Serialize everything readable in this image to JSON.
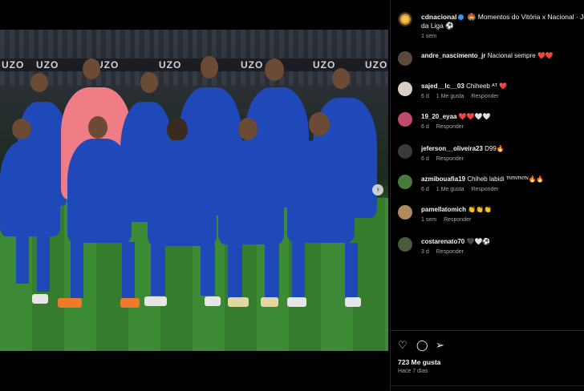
{
  "post": {
    "author": "cdnacional",
    "caption_line1": " 🏟️ Momentos do Vitória x Nacional · Jorn",
    "caption_line2": "da Liga ⚽",
    "time": "1 sem",
    "likes": "723 Me gusta",
    "posted": "Hace 7 días",
    "carousel_dots": 8,
    "carousel_active": 1
  },
  "photo": {
    "banner_words": [
      "UZO",
      "UZO",
      "UZO",
      "UZO",
      "UZO",
      "UZO",
      "UZO"
    ],
    "next_icon": "›"
  },
  "comments": [
    {
      "user": "andre_nascimento_jr",
      "text": "Nacional sempre ❤️❤️",
      "meta": [],
      "avatar_color": "#5a4a3c"
    },
    {
      "user": "sajed__lc__03",
      "text": "Chiheeb ᴬᵀ ❤️",
      "meta": [
        "6 d",
        "1 Me gusta",
        "Responder"
      ],
      "avatar_color": "#d8cfc4"
    },
    {
      "user": "19_20_eyaa",
      "text": "❤️❤️🤍🤍",
      "meta": [
        "6 d",
        "Responder"
      ],
      "avatar_color": "#c04a6a"
    },
    {
      "user": "jeferson__oliveira23",
      "text": "D99🔥",
      "meta": [
        "6 d",
        "Responder"
      ],
      "avatar_color": "#3a3a3a"
    },
    {
      "user": "azmibouafia19",
      "text": "Chiheb labidi ᵀᴺᵀᴺᵀᴺᵀᴺ🔥🔥",
      "meta": [
        "6 d",
        "1 Me gusta",
        "Responder"
      ],
      "avatar_color": "#4a7a3a"
    },
    {
      "user": "pamellatomich",
      "text": "👏👏👏",
      "meta": [
        "1 sem",
        "Responder"
      ],
      "avatar_color": "#b08a5a"
    },
    {
      "user": "costarenato70",
      "text": "🖤🤍⚽",
      "meta": [
        "3 d",
        "Responder"
      ],
      "avatar_color": "#4a5a3a"
    }
  ],
  "icons": {
    "like": "♡",
    "comment": "◯",
    "share": "➢",
    "comment_like": "♡"
  }
}
